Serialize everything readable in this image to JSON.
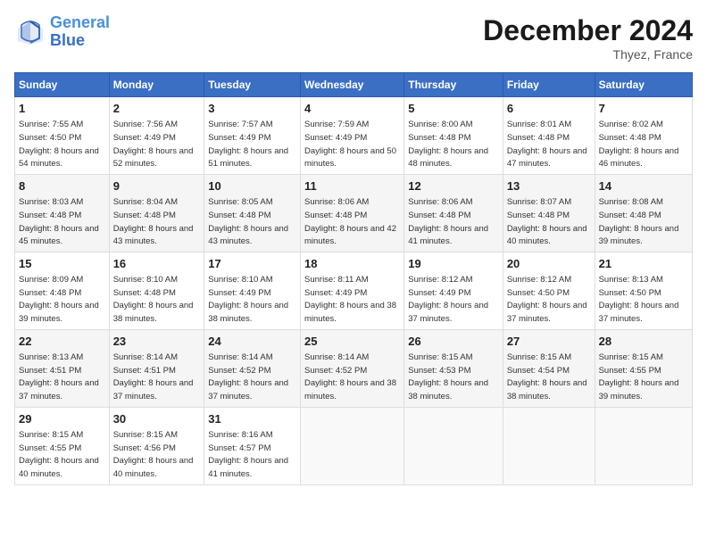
{
  "header": {
    "logo_line1": "General",
    "logo_line2": "Blue",
    "month_title": "December 2024",
    "location": "Thyez, France"
  },
  "days_of_week": [
    "Sunday",
    "Monday",
    "Tuesday",
    "Wednesday",
    "Thursday",
    "Friday",
    "Saturday"
  ],
  "weeks": [
    [
      {
        "day": "1",
        "sunrise": "7:55 AM",
        "sunset": "4:50 PM",
        "daylight": "8 hours and 54 minutes."
      },
      {
        "day": "2",
        "sunrise": "7:56 AM",
        "sunset": "4:49 PM",
        "daylight": "8 hours and 52 minutes."
      },
      {
        "day": "3",
        "sunrise": "7:57 AM",
        "sunset": "4:49 PM",
        "daylight": "8 hours and 51 minutes."
      },
      {
        "day": "4",
        "sunrise": "7:59 AM",
        "sunset": "4:49 PM",
        "daylight": "8 hours and 50 minutes."
      },
      {
        "day": "5",
        "sunrise": "8:00 AM",
        "sunset": "4:48 PM",
        "daylight": "8 hours and 48 minutes."
      },
      {
        "day": "6",
        "sunrise": "8:01 AM",
        "sunset": "4:48 PM",
        "daylight": "8 hours and 47 minutes."
      },
      {
        "day": "7",
        "sunrise": "8:02 AM",
        "sunset": "4:48 PM",
        "daylight": "8 hours and 46 minutes."
      }
    ],
    [
      {
        "day": "8",
        "sunrise": "8:03 AM",
        "sunset": "4:48 PM",
        "daylight": "8 hours and 45 minutes."
      },
      {
        "day": "9",
        "sunrise": "8:04 AM",
        "sunset": "4:48 PM",
        "daylight": "8 hours and 43 minutes."
      },
      {
        "day": "10",
        "sunrise": "8:05 AM",
        "sunset": "4:48 PM",
        "daylight": "8 hours and 43 minutes."
      },
      {
        "day": "11",
        "sunrise": "8:06 AM",
        "sunset": "4:48 PM",
        "daylight": "8 hours and 42 minutes."
      },
      {
        "day": "12",
        "sunrise": "8:06 AM",
        "sunset": "4:48 PM",
        "daylight": "8 hours and 41 minutes."
      },
      {
        "day": "13",
        "sunrise": "8:07 AM",
        "sunset": "4:48 PM",
        "daylight": "8 hours and 40 minutes."
      },
      {
        "day": "14",
        "sunrise": "8:08 AM",
        "sunset": "4:48 PM",
        "daylight": "8 hours and 39 minutes."
      }
    ],
    [
      {
        "day": "15",
        "sunrise": "8:09 AM",
        "sunset": "4:48 PM",
        "daylight": "8 hours and 39 minutes."
      },
      {
        "day": "16",
        "sunrise": "8:10 AM",
        "sunset": "4:48 PM",
        "daylight": "8 hours and 38 minutes."
      },
      {
        "day": "17",
        "sunrise": "8:10 AM",
        "sunset": "4:49 PM",
        "daylight": "8 hours and 38 minutes."
      },
      {
        "day": "18",
        "sunrise": "8:11 AM",
        "sunset": "4:49 PM",
        "daylight": "8 hours and 38 minutes."
      },
      {
        "day": "19",
        "sunrise": "8:12 AM",
        "sunset": "4:49 PM",
        "daylight": "8 hours and 37 minutes."
      },
      {
        "day": "20",
        "sunrise": "8:12 AM",
        "sunset": "4:50 PM",
        "daylight": "8 hours and 37 minutes."
      },
      {
        "day": "21",
        "sunrise": "8:13 AM",
        "sunset": "4:50 PM",
        "daylight": "8 hours and 37 minutes."
      }
    ],
    [
      {
        "day": "22",
        "sunrise": "8:13 AM",
        "sunset": "4:51 PM",
        "daylight": "8 hours and 37 minutes."
      },
      {
        "day": "23",
        "sunrise": "8:14 AM",
        "sunset": "4:51 PM",
        "daylight": "8 hours and 37 minutes."
      },
      {
        "day": "24",
        "sunrise": "8:14 AM",
        "sunset": "4:52 PM",
        "daylight": "8 hours and 37 minutes."
      },
      {
        "day": "25",
        "sunrise": "8:14 AM",
        "sunset": "4:52 PM",
        "daylight": "8 hours and 38 minutes."
      },
      {
        "day": "26",
        "sunrise": "8:15 AM",
        "sunset": "4:53 PM",
        "daylight": "8 hours and 38 minutes."
      },
      {
        "day": "27",
        "sunrise": "8:15 AM",
        "sunset": "4:54 PM",
        "daylight": "8 hours and 38 minutes."
      },
      {
        "day": "28",
        "sunrise": "8:15 AM",
        "sunset": "4:55 PM",
        "daylight": "8 hours and 39 minutes."
      }
    ],
    [
      {
        "day": "29",
        "sunrise": "8:15 AM",
        "sunset": "4:55 PM",
        "daylight": "8 hours and 40 minutes."
      },
      {
        "day": "30",
        "sunrise": "8:15 AM",
        "sunset": "4:56 PM",
        "daylight": "8 hours and 40 minutes."
      },
      {
        "day": "31",
        "sunrise": "8:16 AM",
        "sunset": "4:57 PM",
        "daylight": "8 hours and 41 minutes."
      },
      null,
      null,
      null,
      null
    ]
  ]
}
